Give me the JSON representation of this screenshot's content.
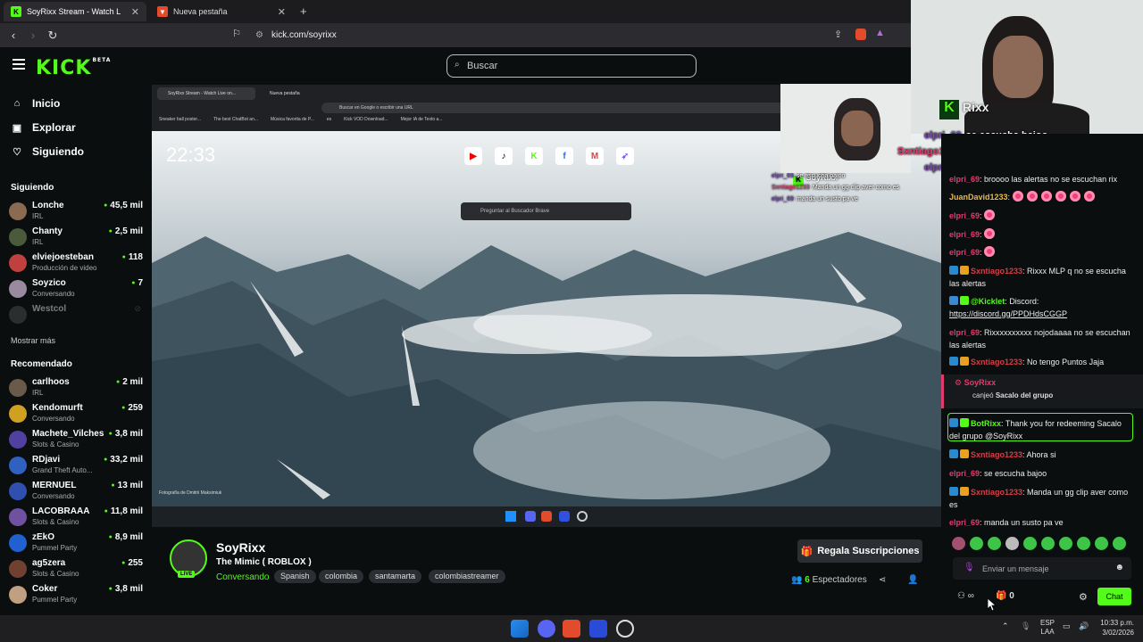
{
  "browser": {
    "tabs": [
      {
        "label": "SoyRixx Stream - Watch Live",
        "active": true
      },
      {
        "label": "Nueva pestaña",
        "active": false
      }
    ],
    "url": "kick.com/soyrixx",
    "new_tab": "+"
  },
  "header": {
    "logo": "KICK",
    "logo_badge": "BETA",
    "search_placeholder": "Buscar"
  },
  "sidebar": {
    "nav": [
      {
        "label": "Inicio",
        "icon": "home-icon"
      },
      {
        "label": "Explorar",
        "icon": "compass-icon"
      },
      {
        "label": "Siguiendo",
        "icon": "heart-icon"
      }
    ],
    "following_title": "Siguiendo",
    "following": [
      {
        "name": "Lonche",
        "category": "IRL",
        "viewers": "45,5 mil",
        "color": "#8a6a50"
      },
      {
        "name": "Chanty",
        "category": "IRL",
        "viewers": "2,5 mil",
        "color": "#4a5a3a"
      },
      {
        "name": "elviejoesteban",
        "category": "Producción de video",
        "viewers": "118",
        "color": "#c04040"
      },
      {
        "name": "Soyzico",
        "category": "Conversando",
        "viewers": "7",
        "color": "#9a8aa0"
      },
      {
        "name": "Westcol",
        "category": "",
        "viewers": "",
        "color": "#555"
      }
    ],
    "show_more": "Mostrar más",
    "recommended_title": "Recomendado",
    "recommended": [
      {
        "name": "carlhoos",
        "category": "IRL",
        "viewers": "2 mil",
        "color": "#6a5a4a"
      },
      {
        "name": "Kendomurft",
        "category": "Conversando",
        "viewers": "259",
        "color": "#d0a020"
      },
      {
        "name": "Machete_Vilches",
        "category": "Slots & Casino",
        "viewers": "3,8 mil",
        "color": "#5040a0"
      },
      {
        "name": "RDjavi",
        "category": "Grand Theft Auto...",
        "viewers": "33,2 mil",
        "color": "#3060c0"
      },
      {
        "name": "MERNUEL",
        "category": "Conversando",
        "viewers": "13 mil",
        "color": "#3050b0"
      },
      {
        "name": "LACOBRAAA",
        "category": "Slots & Casino",
        "viewers": "11,8 mil",
        "color": "#7050a0"
      },
      {
        "name": "zEkO",
        "category": "Pummel Party",
        "viewers": "8,9 mil",
        "color": "#2060d0"
      },
      {
        "name": "ag5zera",
        "category": "Slots & Casino",
        "viewers": "255",
        "color": "#704030"
      },
      {
        "name": "Coker",
        "category": "Pummel Party",
        "viewers": "3,8 mil",
        "color": "#c0a080"
      }
    ]
  },
  "stream": {
    "inner_clock": "22:33",
    "inner_tabs": [
      "SoyRixx Stream - Watch Live on...",
      "Nueva pestaña"
    ],
    "inner_url": "Buscar en Google o escribir una URL",
    "inner_bookmarks": [
      "Sneaker ball poster...",
      "The best ChatBot an...",
      "Música favorita de P...",
      "es",
      "Kick VOD Download...",
      "Mejor IA de Texto a..."
    ],
    "inner_ask": "Preguntar al Buscador Brave",
    "photo_credit": "Fotografía de Dmitrii Maksimiuk",
    "cam_label": "SoyRixx",
    "cam_overlay_label": "Rixx"
  },
  "channel": {
    "name": "SoyRixx",
    "live": "LIVE",
    "title": "The Mimic ( ROBLOX )",
    "category": "Conversando",
    "tags": [
      "Spanish",
      "colombia",
      "santamarta",
      "colombiastreamer"
    ],
    "sub_button": "Regala Suscripciones",
    "viewers_count": "6",
    "viewers_label": "Espectadores"
  },
  "overlay_chat": [
    {
      "user": "elpri_69",
      "text": "se escucha bajoo"
    },
    {
      "user": "Sxntiago1233",
      "text": "Manda un gg clip aver como es"
    },
    {
      "user": "elpri_69",
      "text": "manda un susto pa ve"
    }
  ],
  "small_overlay_chat": [
    {
      "user": "elpri_69",
      "text": "se escucha bajoo"
    },
    {
      "user": "Sxntiago1233",
      "text": "Manda un gg clip aver como es"
    },
    {
      "user": "elpri_69",
      "text": "manda un susto pa ve"
    }
  ],
  "chat": {
    "messages": [
      {
        "user": "elpri_69",
        "text": "broooo las alertas no se escuchan rix"
      },
      {
        "user": "JuanDavid1233",
        "text": ""
      },
      {
        "user": "elpri_69",
        "text": ""
      },
      {
        "user": "elpri_69",
        "text": ""
      },
      {
        "user": "elpri_69",
        "text": ""
      },
      {
        "user": "Sxntiago1233",
        "text": "Rixxx MLP q no se escucha las alertas"
      },
      {
        "user": "@Kicklet",
        "text": "Discord: "
      },
      {
        "link": "https://discord.gg/PPDHdsCGGP"
      },
      {
        "user": "elpri_69",
        "text": "Rixxxxxxxxxx nojodaaaa no se escuchan las alertas"
      },
      {
        "user": "Sxntiago1233",
        "text": "No tengo Puntos Jaja"
      },
      {
        "user": "BotRixx",
        "text": "Thank you for redeeming Sacalo del grupo @SoyRixx"
      },
      {
        "user": "Sxntiago1233",
        "text": "Ahora si"
      },
      {
        "user": "elpri_69",
        "text": "se escucha bajoo"
      },
      {
        "user": "Sxntiago1233",
        "text": "Manda un gg clip aver como es"
      },
      {
        "user": "elpri_69",
        "text": "manda un susto pa ve"
      }
    ],
    "redeem": {
      "user": "SoyRixx",
      "action": "canjeó",
      "reward": "Sacalo del grupo"
    },
    "input_placeholder": "Enviar un mensaje",
    "send_button": "Chat",
    "points": "0",
    "infinity": "∞"
  },
  "os": {
    "lang_top": "ESP",
    "lang_bottom": "LAA",
    "time": "10:33 p.m.",
    "date": "3/02/2026"
  },
  "colors": {
    "accent": "#53fc18",
    "pink": "#e23b6d"
  }
}
